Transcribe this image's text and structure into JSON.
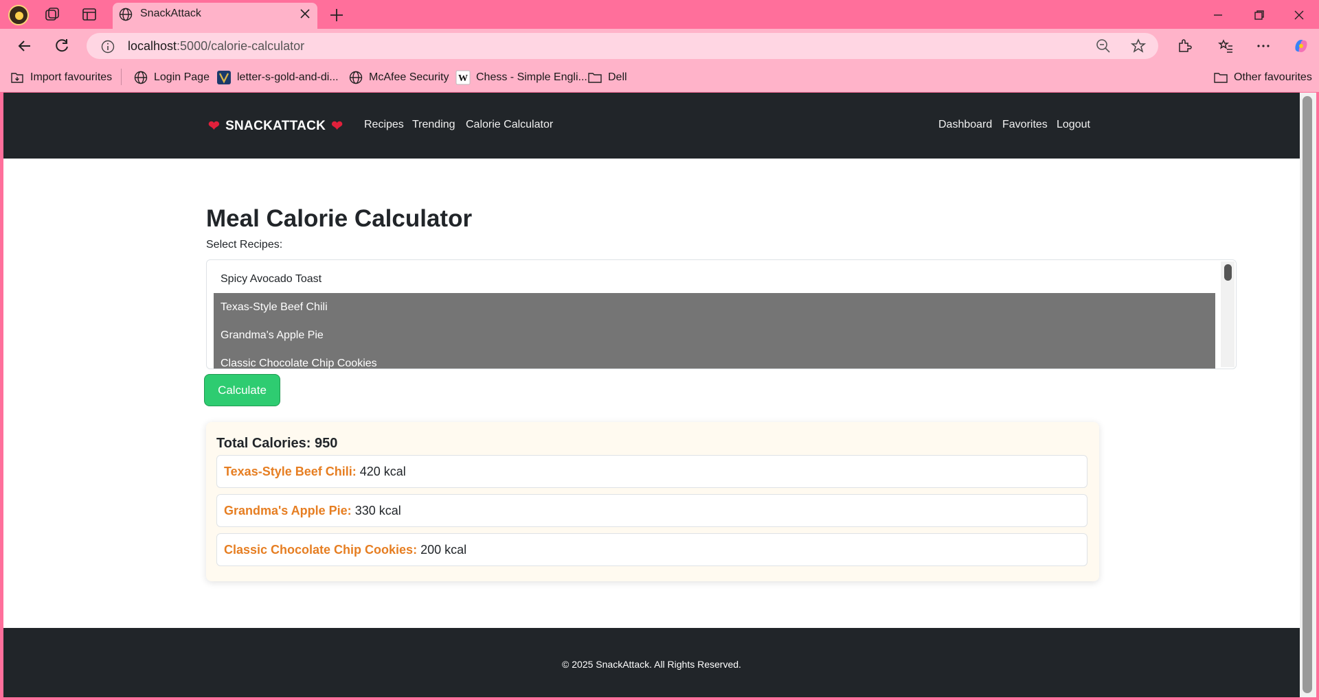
{
  "browser": {
    "tab_title": "SnackAttack",
    "url_host": "localhost",
    "url_path": ":5000/calorie-calculator",
    "bookmarks": [
      {
        "label": "Import favourites",
        "icon": "import-icon"
      },
      {
        "label": "Login Page",
        "icon": "globe-icon"
      },
      {
        "label": "letter-s-gold-and-di...",
        "icon": "v-logo-icon"
      },
      {
        "label": "McAfee Security",
        "icon": "globe-icon"
      },
      {
        "label": "Chess - Simple Engli...",
        "icon": "wikipedia-icon"
      },
      {
        "label": "Dell",
        "icon": "folder-icon"
      }
    ],
    "other_favourites": "Other favourites"
  },
  "site_nav": {
    "brand": "SNACKATTACK",
    "links_left": [
      "Recipes",
      "Trending",
      "Calorie Calculator"
    ],
    "links_right": [
      "Dashboard",
      "Favorites",
      "Logout"
    ]
  },
  "page": {
    "title": "Meal Calorie Calculator",
    "select_label": "Select Recipes:",
    "recipes": [
      {
        "name": "Spicy Avocado Toast",
        "selected": false
      },
      {
        "name": "Texas-Style Beef Chili",
        "selected": true
      },
      {
        "name": "Grandma's Apple Pie",
        "selected": true
      },
      {
        "name": "Classic Chocolate Chip Cookies",
        "selected": true
      }
    ],
    "calculate_label": "Calculate"
  },
  "results": {
    "total_label": "Total Calories: 950",
    "items": [
      {
        "name": "Texas-Style Beef Chili:",
        "kcal": "420 kcal"
      },
      {
        "name": "Grandma's Apple Pie:",
        "kcal": "330 kcal"
      },
      {
        "name": "Classic Chocolate Chip Cookies:",
        "kcal": "200 kcal"
      }
    ]
  },
  "footer": {
    "text": "© 2025 SnackAttack. All Rights Reserved."
  },
  "colors": {
    "browser_frame": "#ff6f9b",
    "browser_toolbar": "#ffb3c9",
    "site_dark": "#212529",
    "accent_orange": "#e67e22",
    "button_green": "#2ecc71",
    "selected_option": "#757575"
  }
}
